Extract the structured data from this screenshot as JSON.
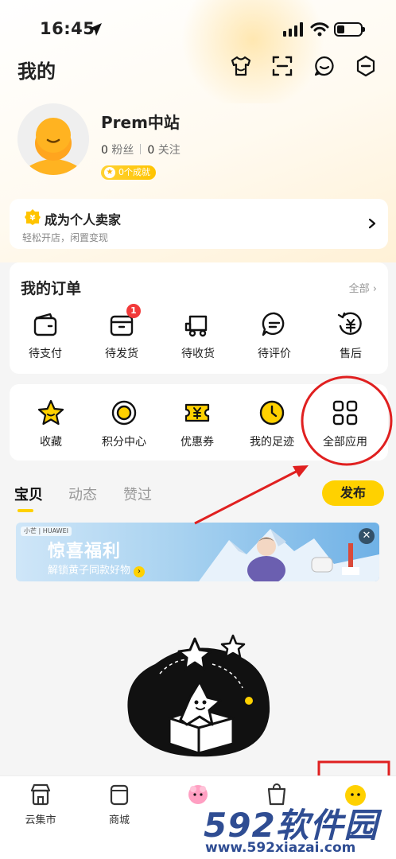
{
  "status_bar": {
    "time": "16:45"
  },
  "header": {
    "title": "我的"
  },
  "profile": {
    "name": "Prem中站",
    "fans_count": "0",
    "fans_label": "粉丝",
    "following_count": "0",
    "following_label": "关注",
    "achievements": "0个成就"
  },
  "seller_card": {
    "title": "成为个人卖家",
    "subtitle": "轻松开店，闲置变现"
  },
  "orders": {
    "title": "我的订单",
    "all_label": "全部",
    "items": [
      {
        "label": "待支付",
        "icon": "wallet-icon"
      },
      {
        "label": "待发货",
        "icon": "package-icon",
        "badge": "1"
      },
      {
        "label": "待收货",
        "icon": "truck-icon"
      },
      {
        "label": "待评价",
        "icon": "comment-icon"
      },
      {
        "label": "售后",
        "icon": "refund-icon"
      }
    ]
  },
  "tools": {
    "items": [
      {
        "label": "收藏",
        "icon": "star-icon"
      },
      {
        "label": "积分中心",
        "icon": "coin-icon"
      },
      {
        "label": "优惠券",
        "icon": "coupon-icon"
      },
      {
        "label": "我的足迹",
        "icon": "clock-icon"
      },
      {
        "label": "全部应用",
        "icon": "grid-icon"
      }
    ]
  },
  "content_tabs": {
    "tabs": [
      {
        "label": "宝贝"
      },
      {
        "label": "动态"
      },
      {
        "label": "赞过"
      }
    ],
    "active_index": 0,
    "publish_label": "发布"
  },
  "banner": {
    "brand_tag": "小芒 | HUAWEI",
    "title": "惊喜福利",
    "subtitle": "解锁黄子同款好物"
  },
  "bottom_nav": {
    "items": [
      {
        "label": "云集市",
        "icon": "market-icon"
      },
      {
        "label": "商城",
        "icon": "mall-icon"
      },
      {
        "label": "",
        "icon": "mascot-icon"
      },
      {
        "label": "",
        "icon": "bag-icon"
      },
      {
        "label": "",
        "icon": "me-face-icon"
      }
    ]
  },
  "watermark": {
    "text": "592软件园",
    "url": "www.592xiazai.com"
  },
  "colors": {
    "accent": "#ffd100",
    "annotation_red": "#e02020",
    "badge_red": "#f23a3a",
    "watermark_blue": "#2f4d93"
  }
}
